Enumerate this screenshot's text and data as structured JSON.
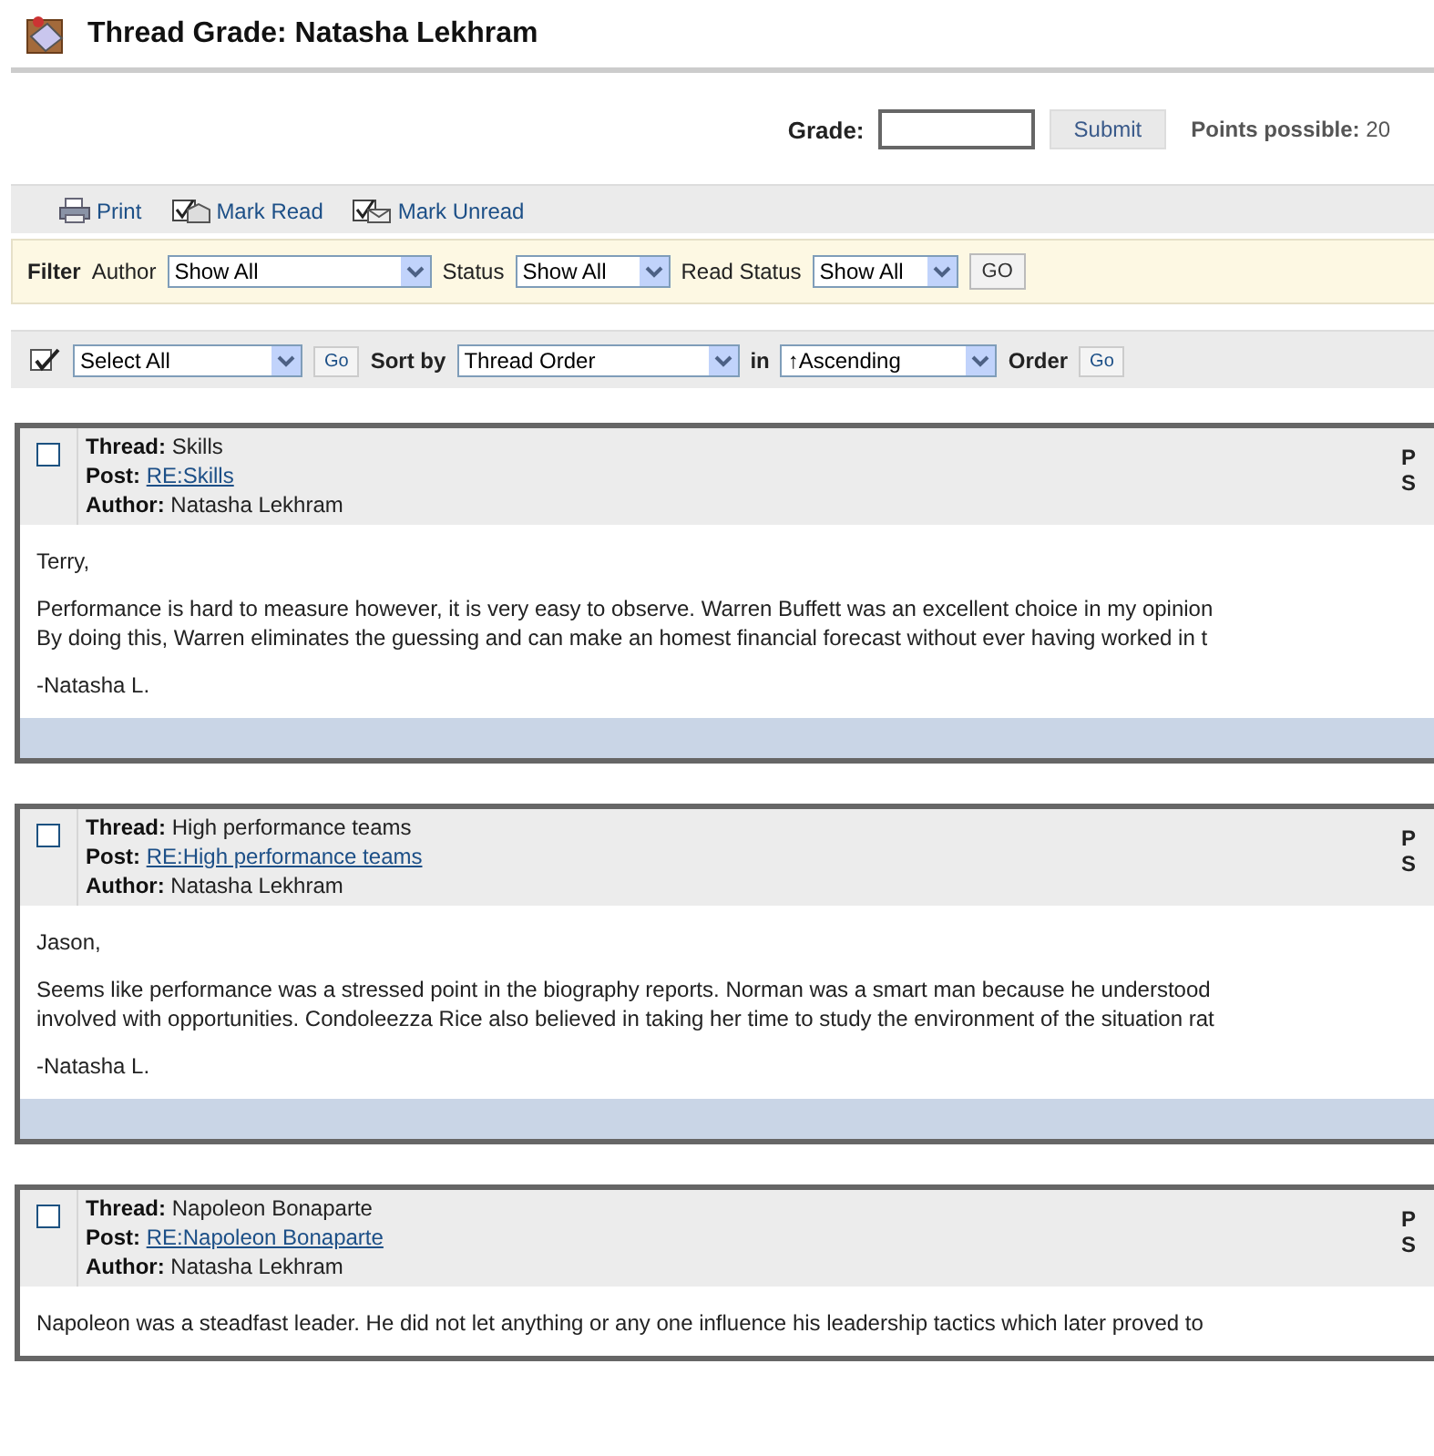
{
  "page_title": "Thread Grade: Natasha Lekhram",
  "grade": {
    "label": "Grade:",
    "submit": "Submit",
    "points_label": "Points possible:",
    "points_value": "20"
  },
  "actions": [
    {
      "kind": "print",
      "label": "Print"
    },
    {
      "kind": "mark_read",
      "label": "Mark Read"
    },
    {
      "kind": "mark_unread",
      "label": "Mark Unread"
    }
  ],
  "filter": {
    "title": "Filter",
    "fields": [
      {
        "label": "Author",
        "value": "Show All"
      },
      {
        "label": "Status",
        "value": "Show All"
      },
      {
        "label": "Read Status",
        "value": "Show All"
      }
    ],
    "go": "GO"
  },
  "sort_bar": {
    "select": "Select All",
    "go": "Go",
    "sort_label": "Sort by",
    "sort_value": "Thread Order",
    "in_label": "in",
    "order_value": "↑Ascending",
    "order_label": "Order",
    "order_go": "Go"
  },
  "posts": [
    {
      "checked": false,
      "thread_label": "Thread:",
      "thread": "Skills",
      "post_label": "Post:",
      "post": "RE:Skills",
      "author_label": "Author:",
      "author": "Natasha Lekhram",
      "side": [
        "P",
        "S"
      ],
      "paragraphs": [
        [
          "Terry,"
        ],
        [
          "Performance is hard to measure however, it is very easy to observe. Warren Buffett was an excellent choice in my opinion",
          "By doing this, Warren eliminates the guessing and can make an homest financial forecast without ever having worked in t"
        ],
        [
          "-Natasha L."
        ]
      ]
    },
    {
      "checked": false,
      "thread_label": "Thread:",
      "thread": "High performance teams",
      "post_label": "Post:",
      "post": "RE:High performance teams",
      "author_label": "Author:",
      "author": "Natasha Lekhram",
      "side": [
        "P",
        "S"
      ],
      "paragraphs": [
        [
          "Jason,"
        ],
        [
          "Seems like performance was a stressed point in the biography reports. Norman was a smart man because he understood",
          "involved with opportunities. Condoleezza Rice also believed in taking her time to study the environment of the situation rat"
        ],
        [
          "-Natasha L."
        ]
      ]
    },
    {
      "checked": false,
      "thread_label": "Thread:",
      "thread": "Napoleon Bonaparte",
      "post_label": "Post:",
      "post": "RE:Napoleon Bonaparte",
      "author_label": "Author:",
      "author": "Natasha Lekhram",
      "side": [
        "P",
        "S"
      ],
      "paragraphs": [
        [
          "Napoleon was a steadfast leader. He did not let anything or any one influence his leadership tactics which later proved to"
        ]
      ],
      "footer": false
    }
  ]
}
